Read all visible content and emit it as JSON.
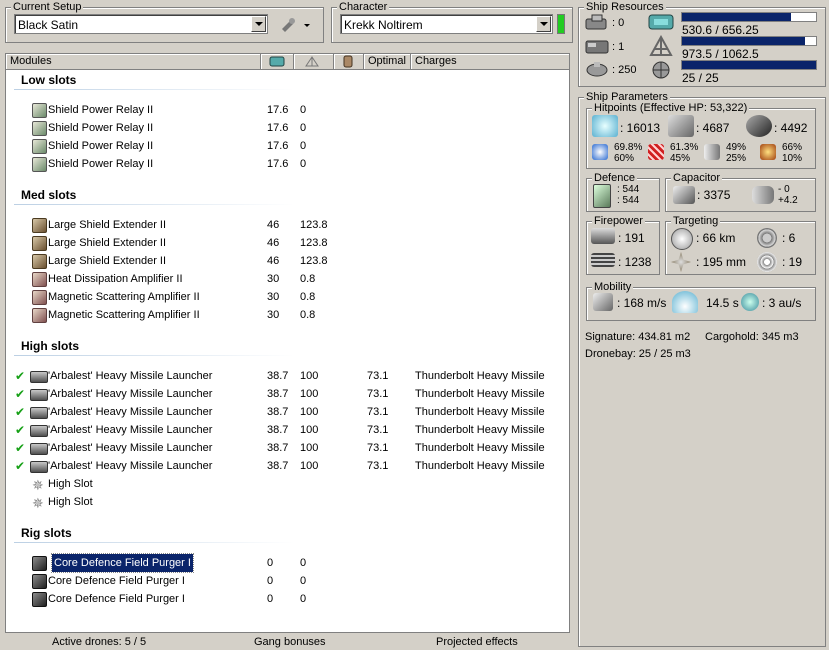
{
  "setup": {
    "label": "Current Setup",
    "value": "Black Satin"
  },
  "character": {
    "label": "Character",
    "value": "Krekk Noltirem"
  },
  "columns": {
    "modules": "Modules",
    "optimal": "Optimal",
    "charges": "Charges"
  },
  "sections": {
    "low": "Low slots",
    "med": "Med slots",
    "high": "High slots",
    "rig": "Rig slots"
  },
  "low": [
    {
      "name": "Shield Power Relay II",
      "cpu": "17.6",
      "pg": "0"
    },
    {
      "name": "Shield Power Relay II",
      "cpu": "17.6",
      "pg": "0"
    },
    {
      "name": "Shield Power Relay II",
      "cpu": "17.6",
      "pg": "0"
    },
    {
      "name": "Shield Power Relay II",
      "cpu": "17.6",
      "pg": "0"
    }
  ],
  "med": [
    {
      "name": "Large Shield Extender II",
      "cpu": "46",
      "pg": "123.8",
      "icon": "shield-extender-icon"
    },
    {
      "name": "Large Shield Extender II",
      "cpu": "46",
      "pg": "123.8",
      "icon": "shield-extender-icon"
    },
    {
      "name": "Large Shield Extender II",
      "cpu": "46",
      "pg": "123.8",
      "icon": "shield-extender-icon"
    },
    {
      "name": "Heat Dissipation Amplifier II",
      "cpu": "30",
      "pg": "0.8",
      "icon": "amplifier-icon"
    },
    {
      "name": "Magnetic Scattering Amplifier II",
      "cpu": "30",
      "pg": "0.8",
      "icon": "amplifier-icon"
    },
    {
      "name": "Magnetic Scattering Amplifier II",
      "cpu": "30",
      "pg": "0.8",
      "icon": "amplifier-icon"
    }
  ],
  "high": [
    {
      "name": "'Arbalest' Heavy Missile Launcher",
      "cpu": "38.7",
      "pg": "100",
      "optimal": "73.1",
      "charge": "Thunderbolt Heavy Missile"
    },
    {
      "name": "'Arbalest' Heavy Missile Launcher",
      "cpu": "38.7",
      "pg": "100",
      "optimal": "73.1",
      "charge": "Thunderbolt Heavy Missile"
    },
    {
      "name": "'Arbalest' Heavy Missile Launcher",
      "cpu": "38.7",
      "pg": "100",
      "optimal": "73.1",
      "charge": "Thunderbolt Heavy Missile"
    },
    {
      "name": "'Arbalest' Heavy Missile Launcher",
      "cpu": "38.7",
      "pg": "100",
      "optimal": "73.1",
      "charge": "Thunderbolt Heavy Missile"
    },
    {
      "name": "'Arbalest' Heavy Missile Launcher",
      "cpu": "38.7",
      "pg": "100",
      "optimal": "73.1",
      "charge": "Thunderbolt Heavy Missile"
    },
    {
      "name": "'Arbalest' Heavy Missile Launcher",
      "cpu": "38.7",
      "pg": "100",
      "optimal": "73.1",
      "charge": "Thunderbolt Heavy Missile"
    }
  ],
  "high_empty": [
    "High Slot",
    "High Slot"
  ],
  "rig": [
    {
      "name": "Core Defence Field Purger I",
      "cpu": "0",
      "pg": "0"
    },
    {
      "name": "Core Defence Field Purger I",
      "cpu": "0",
      "pg": "0"
    },
    {
      "name": "Core Defence Field Purger I",
      "cpu": "0",
      "pg": "0"
    }
  ],
  "statusbar": {
    "drones": "Active drones: 5 / 5",
    "gang": "Gang bonuses",
    "projected": "Projected effects"
  },
  "resources": {
    "title": "Ship Resources",
    "hardpoints": [
      ": 0",
      ": 1",
      ": 250"
    ],
    "cpu": {
      "text": "530.6 / 656.25",
      "fraction": 0.81
    },
    "pg": {
      "text": "973.5 / 1062.5",
      "fraction": 0.92
    },
    "calibration": {
      "text": "25 / 25",
      "fraction": 1.0
    }
  },
  "params": {
    "title": "Ship Parameters",
    "hitpoints_title": "Hitpoints (Effective HP: 53,322)",
    "hp": [
      ": 16013",
      ": 4687",
      ": 4492"
    ],
    "resists": [
      {
        "top": "69.8%",
        "bottom": "60%"
      },
      {
        "top": "61.3%",
        "bottom": "45%"
      },
      {
        "top": "49%",
        "bottom": "25%"
      },
      {
        "top": "66%",
        "bottom": "10%"
      }
    ],
    "defence_title": "Defence",
    "defence": [
      ": 544",
      ": 544"
    ],
    "capacitor_title": "Capacitor",
    "capacitor": ": 3375",
    "cap_delta": [
      "- 0",
      "+4.2"
    ],
    "firepower_title": "Firepower",
    "firepower": [
      ": 191",
      ": 1238"
    ],
    "targeting_title": "Targeting",
    "targeting": [
      ": 66 km",
      ": 6",
      ": 195 mm",
      ": 19"
    ],
    "mobility_title": "Mobility",
    "mobility": [
      ": 168 m/s",
      "14.5 s",
      ": 3 au/s"
    ],
    "signature": "Signature: 434.81 m2",
    "cargohold": "Cargohold: 345 m3",
    "dronebay": "Dronebay: 25 / 25 m3"
  },
  "colors": {
    "accent": "#0a246a",
    "check": "#16a016",
    "green_indicator": "#22cc22"
  }
}
